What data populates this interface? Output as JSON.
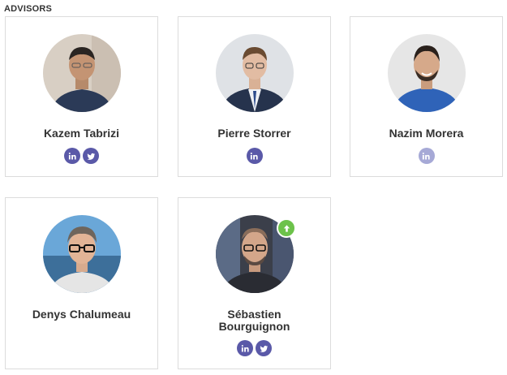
{
  "section": {
    "title": "ADVISORS"
  },
  "colors": {
    "social_active": "#5a59a8",
    "social_disabled": "#a6a9d6",
    "badge_green": "#6cc24a",
    "card_border": "#dcdcdc"
  },
  "advisors": [
    {
      "name": "Kazem Tabrizi",
      "socials": [
        "linkedin-icon",
        "twitter-icon"
      ]
    },
    {
      "name": "Pierre Storrer",
      "socials": [
        "linkedin-icon"
      ]
    },
    {
      "name": "Nazim Morera",
      "socials": [
        "linkedin-icon (disabled)"
      ]
    },
    {
      "name": "Denys Chalumeau",
      "socials": []
    },
    {
      "name_line1": "Sébastien",
      "name_line2": "Bourguignon",
      "socials": [
        "linkedin-icon",
        "twitter-icon"
      ],
      "badge": "arrow-up-icon"
    }
  ]
}
